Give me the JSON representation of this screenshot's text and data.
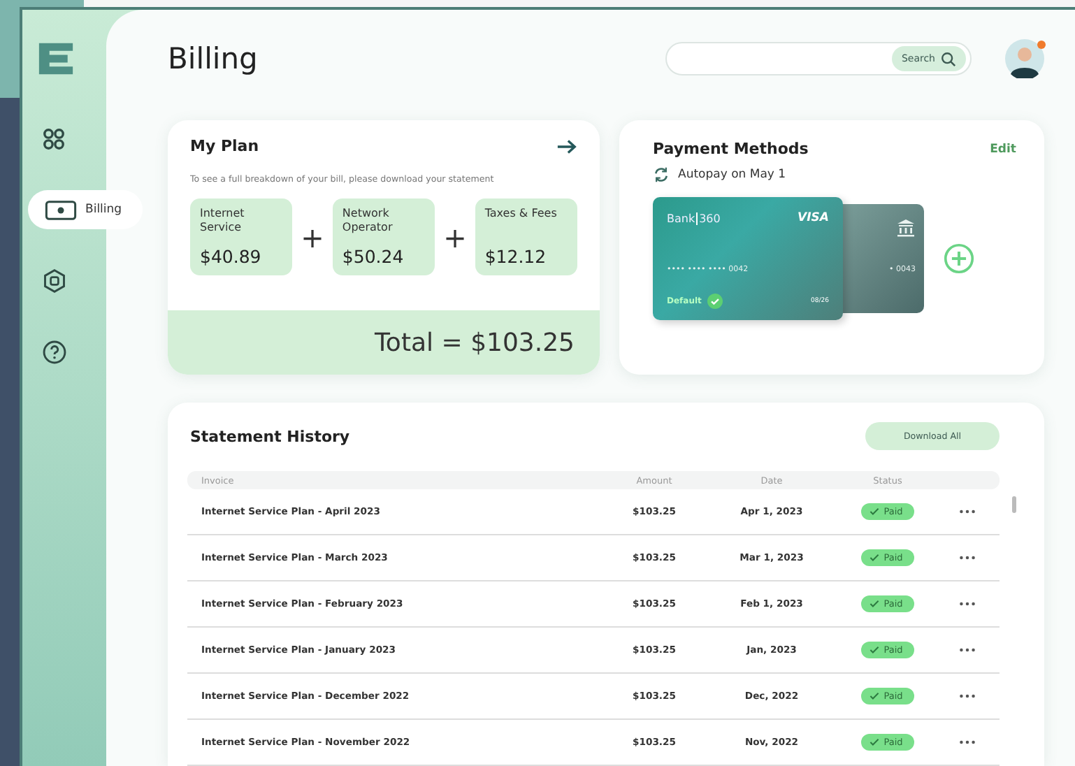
{
  "sidebar": {
    "items": [
      {
        "kind": "grid",
        "selected": false
      },
      {
        "kind": "money",
        "selected": true,
        "label": "Billing"
      },
      {
        "kind": "hexagon",
        "selected": false
      },
      {
        "kind": "help",
        "selected": false
      }
    ]
  },
  "header": {
    "title": "Billing",
    "search": {
      "button": "Search"
    },
    "avatar": {
      "notification": true
    }
  },
  "my_plan": {
    "title": "My Plan",
    "note": "To see a full breakdown of your bill, please download your statement",
    "charges": [
      {
        "label": "Internet Service",
        "amount": "$40.89"
      },
      {
        "label": "Network Operator",
        "amount": "$50.24"
      },
      {
        "label": "Taxes & Fees",
        "amount": "$12.12"
      }
    ],
    "plus": "+",
    "total": "Total = $103.25"
  },
  "payment_methods": {
    "title": "Payment Methods",
    "edit": "Edit",
    "autopay": "Autopay on May 1",
    "cards": [
      {
        "kind": "card",
        "bank": "Bank",
        "bank_suffix": "360",
        "network": "VISA",
        "number": "•••• •••• •••• 0042",
        "default_label": "Default",
        "expiry": "08/26"
      },
      {
        "kind": "bank",
        "number": "• 0043"
      }
    ]
  },
  "statement_history": {
    "title": "Statement History",
    "download": "Download All",
    "columns": [
      "Invoice",
      "Amount",
      "Date",
      "Status"
    ],
    "rows": [
      {
        "invoice": "Internet Service Plan - April 2023",
        "amount": "$103.25",
        "date": "Apr 1, 2023",
        "status": "Paid"
      },
      {
        "invoice": "Internet Service Plan - March 2023",
        "amount": "$103.25",
        "date": "Mar 1, 2023",
        "status": "Paid"
      },
      {
        "invoice": "Internet Service Plan - February 2023",
        "amount": "$103.25",
        "date": "Feb 1, 2023",
        "status": "Paid"
      },
      {
        "invoice": "Internet Service Plan - January 2023",
        "amount": "$103.25",
        "date": "Jan, 2023",
        "status": "Paid"
      },
      {
        "invoice": "Internet Service Plan - December 2022",
        "amount": "$103.25",
        "date": "Dec, 2022",
        "status": "Paid"
      },
      {
        "invoice": "Internet Service Plan - November 2022",
        "amount": "$103.25",
        "date": "Nov, 2022",
        "status": "Paid"
      }
    ]
  }
}
